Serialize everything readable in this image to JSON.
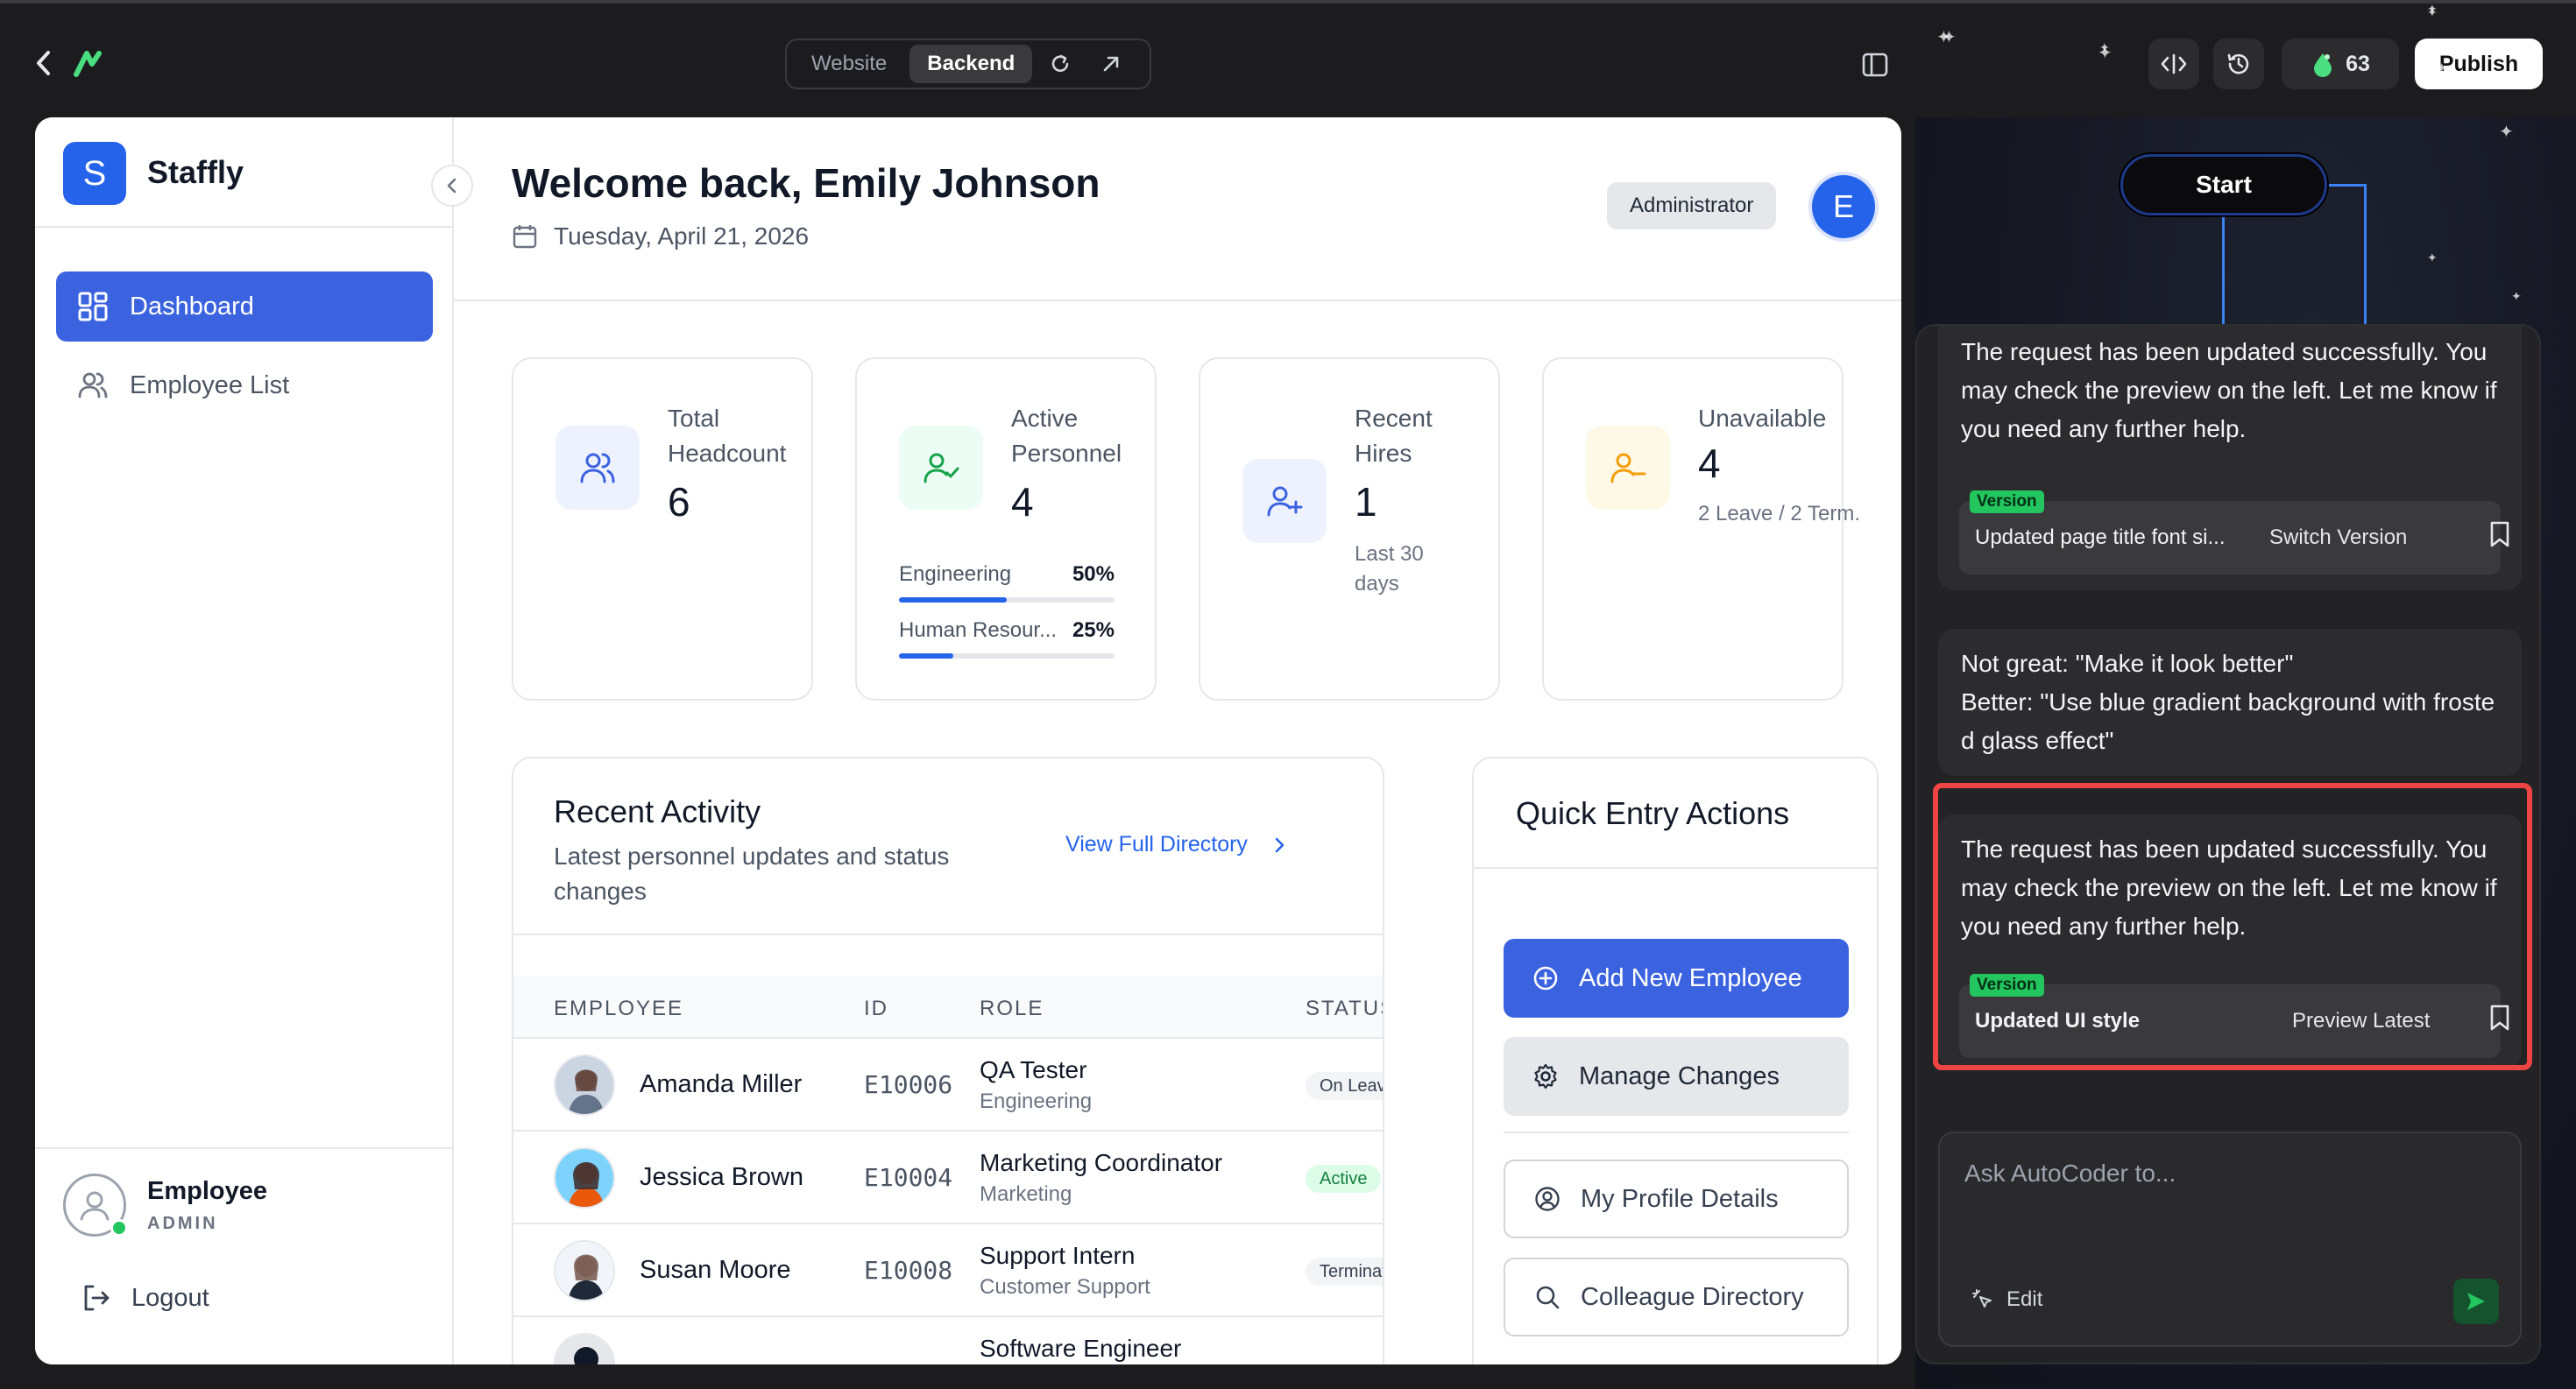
{
  "topbar": {
    "tabs": [
      {
        "label": "Website",
        "active": false
      },
      {
        "label": "Backend",
        "active": true
      }
    ],
    "credits": "63",
    "publish_label": "Publish"
  },
  "sidebar": {
    "brand_letter": "S",
    "brand_name": "Staffly",
    "items": [
      {
        "label": "Dashboard",
        "icon": "grid-icon",
        "active": true
      },
      {
        "label": "Employee List",
        "icon": "users-icon",
        "active": false
      }
    ],
    "user": {
      "name": "Employee",
      "role": "ADMIN"
    },
    "logout_label": "Logout"
  },
  "header": {
    "welcome": "Welcome back, Emily Johnson",
    "date": "Tuesday, April 21, 2026",
    "role_badge": "Administrator",
    "avatar_letter": "E"
  },
  "stats": [
    {
      "label": "Total Headcount",
      "value": "6",
      "sub": "",
      "icon": "users-icon",
      "color": "#eef2ff"
    },
    {
      "label": "Active Personnel",
      "value": "4",
      "sub": "",
      "icon": "user-check-icon",
      "color": "#ecfdf5",
      "departments": [
        {
          "name": "Engineering",
          "pct": "50%",
          "fraction": 0.5
        },
        {
          "name": "Human Resour...",
          "pct": "25%",
          "fraction": 0.25
        }
      ]
    },
    {
      "label": "Recent Hires",
      "value": "1",
      "sub": "Last 30 days",
      "icon": "user-plus-icon",
      "color": "#eef2ff"
    },
    {
      "label": "Unavailable",
      "value": "4",
      "sub": "2 Leave / 2 Term.",
      "icon": "user-minus-icon",
      "color": "#fef9e7"
    }
  ],
  "activity": {
    "title": "Recent Activity",
    "subtitle": "Latest personnel updates and status changes",
    "link_label": "View Full Directory",
    "columns": [
      "EMPLOYEE",
      "ID",
      "ROLE",
      "STATUS"
    ],
    "rows": [
      {
        "name": "Amanda Miller",
        "id": "E10006",
        "role": "QA Tester",
        "dept": "Engineering",
        "status": "On Leave",
        "status_bg": "#f3f4f6",
        "status_fg": "#374151"
      },
      {
        "name": "Jessica Brown",
        "id": "E10004",
        "role": "Marketing Coordinator",
        "dept": "Marketing",
        "status": "Active",
        "status_bg": "#dcfce7",
        "status_fg": "#15803d"
      },
      {
        "name": "Susan Moore",
        "id": "E10008",
        "role": "Support Intern",
        "dept": "Customer Support",
        "status": "Terminated",
        "status_bg": "#f3f4f6",
        "status_fg": "#374151"
      },
      {
        "name": "",
        "id": "",
        "role": "Software Engineer",
        "dept": "",
        "status": "",
        "status_bg": "#ffffff",
        "status_fg": "#374151"
      }
    ]
  },
  "quick_actions": {
    "title": "Quick Entry Actions",
    "buttons": [
      {
        "label": "Add New Employee",
        "icon": "plus-circle-icon",
        "style": "primary"
      },
      {
        "label": "Manage Changes",
        "icon": "gear-icon",
        "style": "secondary"
      },
      {
        "label": "My Profile Details",
        "icon": "user-circle-icon",
        "style": "outline"
      },
      {
        "label": "Colleague Directory",
        "icon": "search-icon",
        "style": "outline"
      }
    ]
  },
  "flow": {
    "start_label": "Start"
  },
  "chat": {
    "messages": [
      {
        "text": "The request has been updated successfully. You may check the preview on the left. Let me know if you need any further help.",
        "version": {
          "tag": "Version",
          "title": "Updated page title font si...",
          "action": "Switch Version"
        }
      },
      {
        "text": "Not great: \"Make it look better\"\nBetter: \"Use blue gradient background with frosted glass effect\""
      },
      {
        "text": "The request has been updated successfully. You may check the preview on the left. Let me know if you need any further help.",
        "version": {
          "tag": "Version",
          "title": "Updated UI style",
          "action": "Preview Latest"
        }
      }
    ],
    "composer_placeholder": "Ask AutoCoder to...",
    "edit_label": "Edit"
  },
  "colors": {
    "accent": "#3b63e0",
    "highlight": "#ef4444",
    "version_tag": "#22c55e"
  }
}
